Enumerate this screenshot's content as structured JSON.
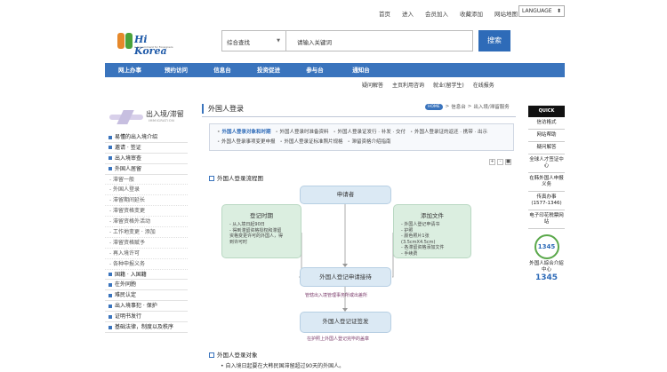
{
  "top_links": [
    "首页",
    "进入",
    "会员加入",
    "收藏添加",
    "网站地图"
  ],
  "language_select": "LANGUAGE",
  "logo": {
    "text": "Hi Korea",
    "sub": "e-Government for Foreigners"
  },
  "search": {
    "category": "综合查找",
    "placeholder": "请输入关键词",
    "button": "搜索"
  },
  "main_nav": [
    "网上办事",
    "预约访问",
    "信息台",
    "投资促进",
    "参与台",
    "通知台"
  ],
  "sub_nav": [
    "疑问解答",
    "主页利用咨询",
    "就业(留学生)",
    "在线报务"
  ],
  "sidebar": {
    "title": "出入境/滞留",
    "title_en": "IMMIGRATION",
    "items": [
      {
        "label": "易懂的出入境介绍",
        "kind": "cat"
      },
      {
        "label": "邀请 · 签证",
        "kind": "cat"
      },
      {
        "label": "出入境审查",
        "kind": "cat"
      },
      {
        "label": "外国人居留",
        "kind": "cat"
      },
      {
        "label": "滞留一般",
        "kind": "sub"
      },
      {
        "label": "外国人登录",
        "kind": "sub"
      },
      {
        "label": "滞留期间延长",
        "kind": "sub"
      },
      {
        "label": "滞留资格变更",
        "kind": "sub"
      },
      {
        "label": "滞留资格外活动",
        "kind": "sub"
      },
      {
        "label": "工作地变更 · 添加",
        "kind": "sub"
      },
      {
        "label": "滞留资格赋予",
        "kind": "sub"
      },
      {
        "label": "再入境许可",
        "kind": "sub"
      },
      {
        "label": "各种申报义务",
        "kind": "sub"
      },
      {
        "label": "国籍 · 入国籍",
        "kind": "cat"
      },
      {
        "label": "在外同胞",
        "kind": "cat"
      },
      {
        "label": "难民认定",
        "kind": "cat"
      },
      {
        "label": "出入境事犯 · 保护",
        "kind": "cat"
      },
      {
        "label": "证明书发行",
        "kind": "cat"
      },
      {
        "label": "基础法律，制度以及秩序",
        "kind": "cat"
      }
    ]
  },
  "page_title": "外国人登录",
  "breadcrumb": {
    "home": "HOME",
    "parts": [
      ">",
      "信息台",
      ">",
      "出入境/滞留服务"
    ]
  },
  "tabs": [
    {
      "label": "外国人登录对象和时期",
      "active": true
    },
    {
      "label": "外国人登录时准备资料",
      "active": false
    },
    {
      "label": "外国人登录证发行 · 补发 · 交付",
      "active": false
    },
    {
      "label": "外国人登录证的返还 · 携带 · 出示",
      "active": false
    },
    {
      "label": "外国人登录事项变更申报",
      "active": false
    },
    {
      "label": "外国人登录证标准照片规格",
      "active": false
    },
    {
      "label": "滞留资格介绍指南",
      "active": false
    }
  ],
  "zoom": [
    "+",
    "-",
    "■"
  ],
  "section1": "外国人登录流程图",
  "flow": {
    "apply": "申请者",
    "period": {
      "title": "登记时期",
      "lines": [
        "- 从入境日起90日",
        "- 得到滞留资格授权和滞留",
        "  资格变更许可的外国人，得",
        "  到许可时"
      ]
    },
    "docs": {
      "title": "添加文件",
      "lines": [
        "- 外国人登记申请书",
        "- 护照",
        "- 颜色照片1张(3.5cmX4.5cm)",
        "- 各滞留资格添加文件",
        "- 手续费"
      ]
    },
    "accept": "外国人登记申请接待",
    "note1": "管辖出入境管理事务所或出差所",
    "issue": "外国人登记证签发",
    "note2": "在护照上外国人登记完毕的盖章"
  },
  "section2": "外国人登录对象",
  "bullet1": "• 自入境日起要在大韩民国滞留超过90天的外国人。",
  "quick": {
    "header": "QUICK",
    "items": [
      "信访格式",
      "网站帮助",
      "疑问解答",
      "全球人才签证中心",
      "在韩外国人申报义务",
      "传真办事 (1577-1346)",
      "电子印花税票网站"
    ],
    "call_center": {
      "logo_num": "1345",
      "caption": "外国人綜合介紹中心",
      "number": "1345"
    }
  }
}
